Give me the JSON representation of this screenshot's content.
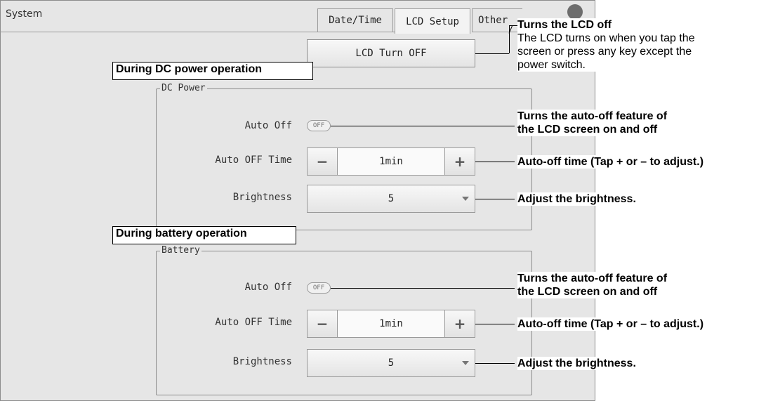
{
  "window": {
    "title": "System"
  },
  "tabs": [
    {
      "label": "Date/Time"
    },
    {
      "label": "LCD Setup"
    },
    {
      "label": "Other"
    }
  ],
  "lcd_turn_off_button": "LCD Turn OFF",
  "sections": {
    "dc": {
      "annotation": "During DC power operation",
      "legend": "DC Power",
      "auto_off_label": "Auto Off",
      "auto_off_state": "OFF",
      "auto_off_time_label": "Auto OFF Time",
      "auto_off_time_value": "1min",
      "brightness_label": "Brightness",
      "brightness_value": "5"
    },
    "battery": {
      "annotation": "During battery operation",
      "legend": "Battery",
      "auto_off_label": "Auto Off",
      "auto_off_state": "OFF",
      "auto_off_time_label": "Auto OFF Time",
      "auto_off_time_value": "1min",
      "brightness_label": "Brightness",
      "brightness_value": "5"
    }
  },
  "icons": {
    "minus": "−",
    "plus": "+"
  },
  "callouts": {
    "lcd_off_title": "Turns the LCD off",
    "lcd_off_note_1": "The LCD turns on when you tap the",
    "lcd_off_note_2": "screen or press any key except the",
    "lcd_off_note_3": "power switch.",
    "dc_auto_off_1": "Turns the auto-off feature of",
    "dc_auto_off_2": "the LCD screen on and off",
    "dc_auto_off_time": "Auto-off time (Tap + or – to adjust.)",
    "dc_brightness": "Adjust the brightness.",
    "bat_auto_off_1": "Turns the auto-off feature of",
    "bat_auto_off_2": "the LCD screen on and off",
    "bat_auto_off_time": "Auto-off time (Tap + or – to adjust.)",
    "bat_brightness": "Adjust the brightness."
  }
}
